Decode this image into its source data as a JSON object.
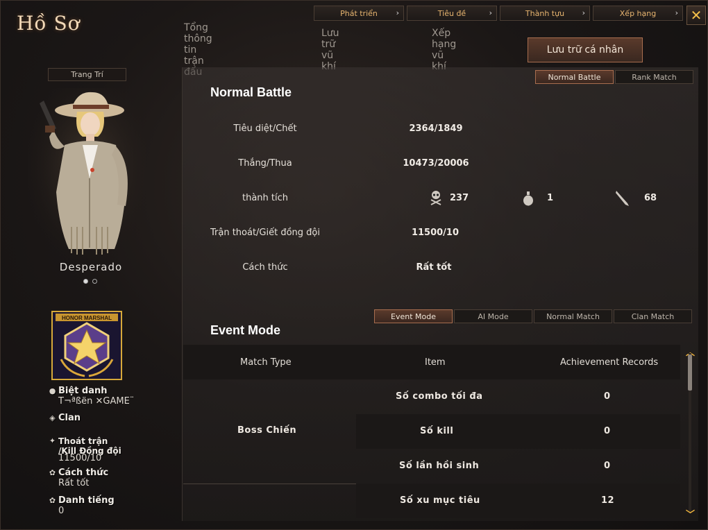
{
  "title": "Hồ Sơ",
  "topnav": [
    "Phát triển",
    "Tiêu đề",
    "Thành tựu",
    "Xếp hạng"
  ],
  "close_icon": "✕",
  "tabs": [
    "Tổng thông tin trận đấu",
    "Lưu trữ vũ khí",
    "Xếp hạng vũ khí",
    "Lưu trữ cá nhân"
  ],
  "active_tab": "Lưu trữ cá nhân",
  "left": {
    "decor_button": "Trang Trí",
    "character_name": "Desperado",
    "carousel_dots": 2,
    "carousel_active": 0,
    "badge_text": "HONOR MARSHAL",
    "nickname_label": "Biệt danh",
    "nickname_value": "T¬ªßën ✕GAME¨",
    "clan_label": "Clan",
    "escape_label_1": "Thoát trận",
    "escape_label_2": "/Kill Đồng đội",
    "escape_value": "11500/10",
    "style_label": "Cách thức",
    "style_value": "Rất tốt",
    "reputation_label": "Danh tiếng",
    "reputation_value": "0"
  },
  "battle_tabs": [
    "Normal Battle",
    "Rank Match"
  ],
  "normal_battle": {
    "heading": "Normal Battle",
    "rows": [
      {
        "label": "Tiêu diệt/Chết",
        "value": "2364/1849"
      },
      {
        "label": "Thắng/Thua",
        "value": "10473/20006"
      },
      {
        "label": "thành tích",
        "value": ""
      },
      {
        "label": "Trận thoát/Giết đồng đội",
        "value": "11500/10"
      },
      {
        "label": "Cách thức",
        "value": "Rất tốt"
      }
    ],
    "achievements": [
      {
        "icon": "skull-crossbones-icon",
        "value": "237"
      },
      {
        "icon": "grenade-icon",
        "value": "1"
      },
      {
        "icon": "knife-icon",
        "value": "68"
      }
    ]
  },
  "mode_tabs": [
    "Event Mode",
    "AI Mode",
    "Normal Match",
    "Clan Match"
  ],
  "event_mode": {
    "heading": "Event Mode",
    "columns": [
      "Match Type",
      "Item",
      "Achievement Records"
    ],
    "match_type": "Boss Chiến",
    "rows": [
      {
        "item": "Số combo tối đa",
        "value": "0"
      },
      {
        "item": "Số kill",
        "value": "0"
      },
      {
        "item": "Số lần hồi sinh",
        "value": "0"
      },
      {
        "item": "Số xu mục tiêu",
        "value": "12"
      }
    ]
  }
}
